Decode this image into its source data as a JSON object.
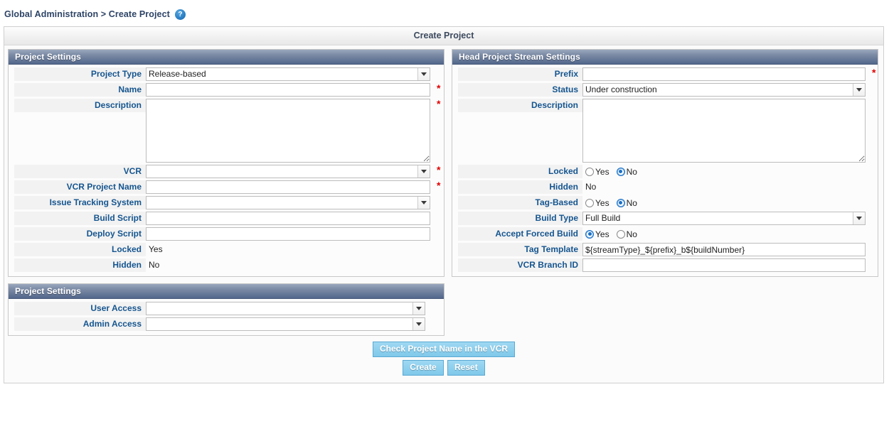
{
  "breadcrumb": {
    "text": "Global Administration > Create Project",
    "help_icon": "help-icon",
    "help_glyph": "?"
  },
  "page": {
    "title": "Create Project"
  },
  "colors": {
    "label_text": "#15558f",
    "panel_header_start": "#9aa8bd",
    "panel_header_end": "#52678c",
    "required_asterisk": "#e30000",
    "button_fill": "#8ed0ee",
    "accent_blue": "#1b6fc4"
  },
  "project_settings": {
    "header": "Project Settings",
    "fields": {
      "project_type": {
        "label": "Project Type",
        "type": "select",
        "value": "Release-based",
        "required": false
      },
      "name": {
        "label": "Name",
        "type": "text",
        "value": "",
        "required": true
      },
      "description": {
        "label": "Description",
        "type": "textarea",
        "value": "",
        "required": true
      },
      "vcr": {
        "label": "VCR",
        "type": "select",
        "value": "",
        "required": true
      },
      "vcr_project_name": {
        "label": "VCR Project Name",
        "type": "text",
        "value": "",
        "required": true
      },
      "issue_tracking_system": {
        "label": "Issue Tracking System",
        "type": "select",
        "value": "",
        "required": false
      },
      "build_script": {
        "label": "Build Script",
        "type": "text",
        "value": "",
        "required": false
      },
      "deploy_script": {
        "label": "Deploy Script",
        "type": "text",
        "value": "",
        "required": false
      },
      "locked": {
        "label": "Locked",
        "type": "static",
        "value": "Yes"
      },
      "hidden": {
        "label": "Hidden",
        "type": "static",
        "value": "No"
      }
    }
  },
  "head_project_stream_settings": {
    "header": "Head Project Stream Settings",
    "fields": {
      "prefix": {
        "label": "Prefix",
        "type": "text",
        "value": "",
        "required": true
      },
      "status": {
        "label": "Status",
        "type": "select",
        "value": "Under construction",
        "required": false
      },
      "description": {
        "label": "Description",
        "type": "textarea",
        "value": "",
        "required": false
      },
      "locked": {
        "label": "Locked",
        "type": "radio",
        "options": [
          "Yes",
          "No"
        ],
        "selected": "No"
      },
      "hidden": {
        "label": "Hidden",
        "type": "static",
        "value": "No"
      },
      "tag_based": {
        "label": "Tag-Based",
        "type": "radio",
        "options": [
          "Yes",
          "No"
        ],
        "selected": "No"
      },
      "build_type": {
        "label": "Build Type",
        "type": "select",
        "value": "Full Build",
        "required": false
      },
      "accept_forced_build": {
        "label": "Accept Forced Build",
        "type": "radio",
        "options": [
          "Yes",
          "No"
        ],
        "selected": "Yes"
      },
      "tag_template": {
        "label": "Tag Template",
        "type": "text",
        "value": "${streamType}_${prefix}_b${buildNumber}",
        "required": false
      },
      "vcr_branch_id": {
        "label": "VCR Branch ID",
        "type": "text",
        "value": "",
        "required": false
      }
    }
  },
  "access_settings": {
    "header": "Project Settings",
    "fields": {
      "user_access": {
        "label": "User Access",
        "type": "select",
        "value": ""
      },
      "admin_access": {
        "label": "Admin Access",
        "type": "select",
        "value": ""
      }
    }
  },
  "buttons": {
    "check_vcr": "Check Project Name in the VCR",
    "create": "Create",
    "reset": "Reset"
  }
}
